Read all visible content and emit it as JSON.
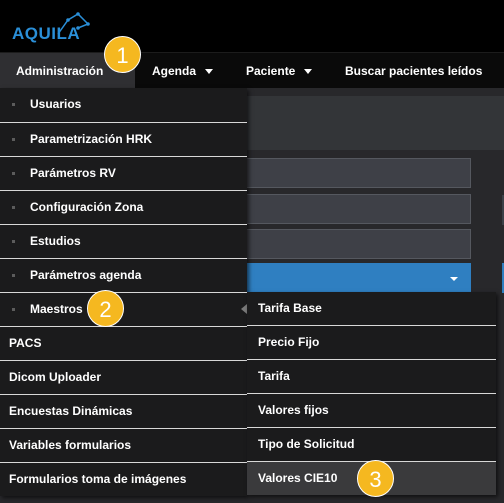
{
  "app": {
    "logo_text": "AQUILA"
  },
  "nav": {
    "items": [
      {
        "label": "Administración"
      },
      {
        "label": "Agenda"
      },
      {
        "label": "Paciente"
      },
      {
        "label": "Buscar pacientes leídos"
      }
    ]
  },
  "admin_menu": {
    "items": [
      {
        "label": "Usuarios"
      },
      {
        "label": "Parametrización HRK"
      },
      {
        "label": "Parámetros RV"
      },
      {
        "label": "Configuración Zona"
      },
      {
        "label": "Estudios"
      },
      {
        "label": "Parámetros agenda"
      },
      {
        "label": "Maestros"
      },
      {
        "label": "PACS"
      },
      {
        "label": "Dicom Uploader"
      },
      {
        "label": "Encuestas Dinámicas"
      },
      {
        "label": "Variables formularios"
      },
      {
        "label": "Formularios toma de imágenes"
      }
    ]
  },
  "maestros_submenu": {
    "items": [
      {
        "label": "Tarifa Base"
      },
      {
        "label": "Precio Fijo"
      },
      {
        "label": "Tarifa"
      },
      {
        "label": "Valores fijos"
      },
      {
        "label": "Tipo de Solicitud"
      },
      {
        "label": "Valores CIE10"
      }
    ]
  },
  "callouts": {
    "one": "1",
    "two": "2",
    "three": "3"
  },
  "colors": {
    "accent": "#2f7fc1",
    "callout": "#f5b820",
    "logo": "#2a8fd8"
  }
}
